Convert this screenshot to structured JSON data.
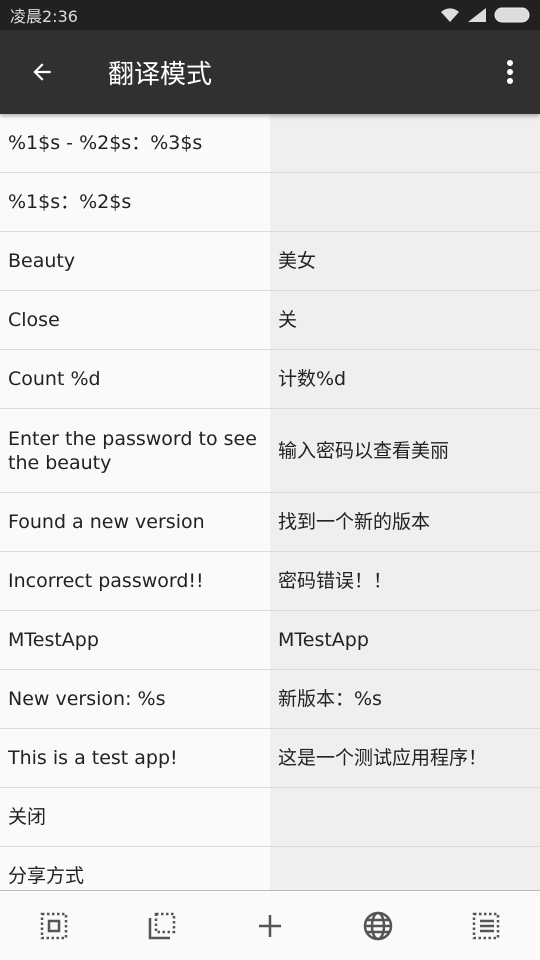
{
  "status": {
    "time": "凌晨2:36"
  },
  "appbar": {
    "title": "翻译模式"
  },
  "rows": [
    {
      "source": "%1$s - %2$s：%3$s",
      "translation": ""
    },
    {
      "source": "%1$s：%2$s",
      "translation": ""
    },
    {
      "source": "Beauty",
      "translation": "美女"
    },
    {
      "source": "Close",
      "translation": "关"
    },
    {
      "source": "Count %d",
      "translation": "计数%d"
    },
    {
      "source": "Enter the password to see the beauty",
      "translation": "输入密码以查看美丽"
    },
    {
      "source": "Found a new version",
      "translation": "找到一个新的版本"
    },
    {
      "source": "Incorrect password!!",
      "translation": "密码错误！！"
    },
    {
      "source": "MTestApp",
      "translation": "MTestApp"
    },
    {
      "source": "New version: %s",
      "translation": "新版本：%s"
    },
    {
      "source": "This is a test app!",
      "translation": "这是一个测试应用程序！"
    },
    {
      "source": "关闭",
      "translation": ""
    },
    {
      "source": "分享方式",
      "translation": ""
    }
  ],
  "toolbar": [
    "select-all-icon",
    "select-partial-icon",
    "add-icon",
    "globe-icon",
    "list-icon"
  ]
}
